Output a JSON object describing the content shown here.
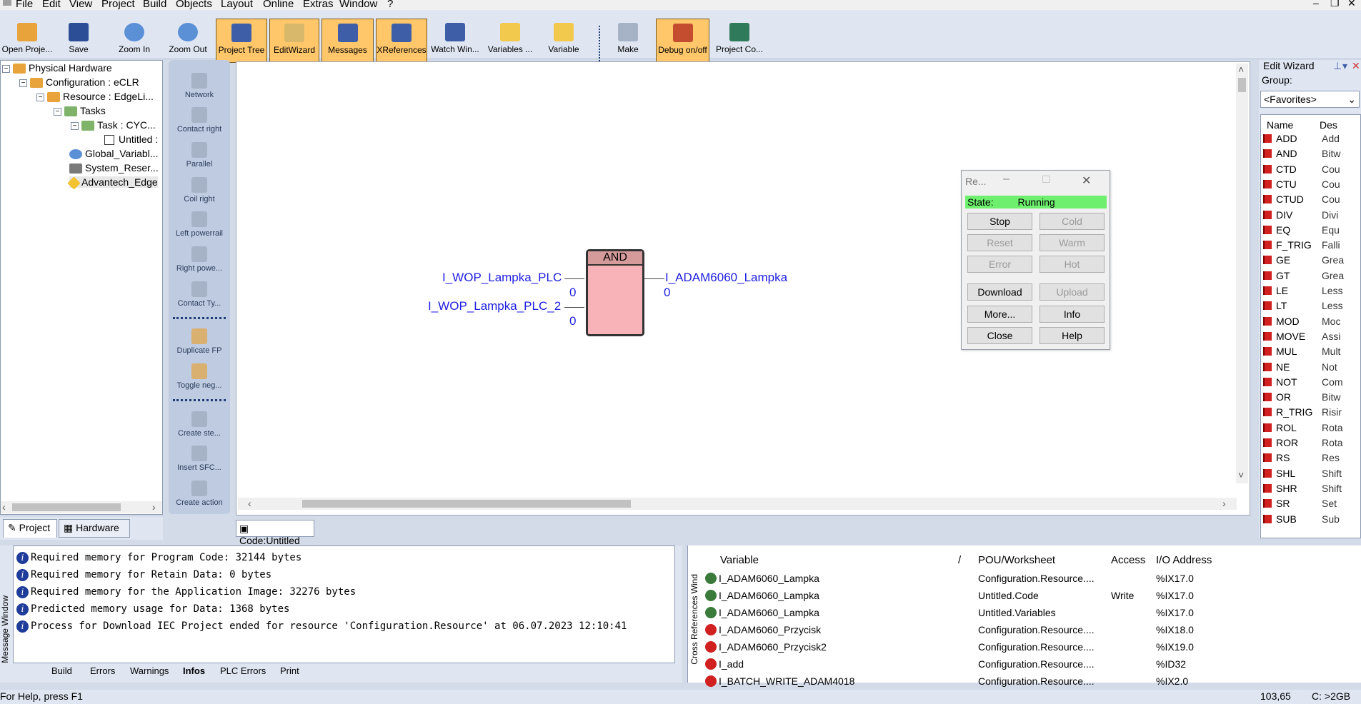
{
  "menu": [
    "File",
    "Edit",
    "View",
    "Project",
    "Build",
    "Objects",
    "Layout",
    "Online",
    "Extras",
    "Window",
    "?"
  ],
  "toolbar": [
    {
      "label": "Open Proje...",
      "icon": "open-project-icon",
      "active": false
    },
    {
      "label": "Save",
      "icon": "save-icon",
      "active": false
    },
    {
      "label": "Zoom In",
      "icon": "zoom-in-icon",
      "active": false
    },
    {
      "label": "Zoom Out",
      "icon": "zoom-out-icon",
      "active": false
    },
    {
      "label": "Project Tree",
      "icon": "project-tree-icon",
      "active": true
    },
    {
      "label": "EditWizard",
      "icon": "edit-wizard-icon",
      "active": true
    },
    {
      "label": "Messages",
      "icon": "messages-icon",
      "active": true
    },
    {
      "label": "XReferences",
      "icon": "xreferences-icon",
      "active": true
    },
    {
      "label": "Watch Win...",
      "icon": "watch-window-icon",
      "active": false
    },
    {
      "label": "Variables ...",
      "icon": "variables-icon",
      "active": false
    },
    {
      "label": "Variable",
      "icon": "variable-icon",
      "active": false
    },
    {
      "label": "Make",
      "icon": "make-icon",
      "active": false
    },
    {
      "label": "Debug on/off",
      "icon": "debug-icon",
      "active": true
    },
    {
      "label": "Project Co...",
      "icon": "project-control-icon",
      "active": false
    }
  ],
  "tree": {
    "items": [
      "Physical Hardware",
      "Configuration : eCLR",
      "Resource : EdgeLi...",
      "Tasks",
      "Task : CYC...",
      "Untitled :",
      "Global_Variabl...",
      "System_Reser...",
      "Advantech_Edge"
    ],
    "tabs": [
      "Project",
      "Hardware"
    ]
  },
  "palette": [
    "Network",
    "Contact right",
    "Parallel",
    "Coil right",
    "Left powerrail",
    "Right powe...",
    "Contact Ty...",
    "Duplicate FP",
    "Toggle neg...",
    "Create ste...",
    "Insert SFC...",
    "Create action"
  ],
  "editor": {
    "block_title": "AND",
    "in1": "I_WOP_Lampka_PLC",
    "in1_val": "0",
    "in2": "I_WOP_Lampka_PLC_2",
    "in2_val": "0",
    "out": "I_ADAM6060_Lampka",
    "out_val": "0",
    "tab": "Code:Untitled"
  },
  "resource_dialog": {
    "title": "Re...",
    "state_label": "State:",
    "state_value": "Running",
    "buttons": [
      {
        "label": "Stop",
        "enabled": true
      },
      {
        "label": "Cold",
        "enabled": false
      },
      {
        "label": "Reset",
        "enabled": false
      },
      {
        "label": "Warm",
        "enabled": false
      },
      {
        "label": "Error",
        "enabled": false
      },
      {
        "label": "Hot",
        "enabled": false
      },
      {
        "label": "Download",
        "enabled": true
      },
      {
        "label": "Upload",
        "enabled": false
      },
      {
        "label": "More...",
        "enabled": true
      },
      {
        "label": "Info",
        "enabled": true
      },
      {
        "label": "Close",
        "enabled": true
      },
      {
        "label": "Help",
        "enabled": true
      }
    ]
  },
  "wizard": {
    "title": "Edit Wizard",
    "group_label": "Group:",
    "group_value": "<Favorites>",
    "col_name": "Name",
    "col_desc": "Des",
    "rows": [
      [
        "ADD",
        "Add"
      ],
      [
        "AND",
        "Bitw"
      ],
      [
        "CTD",
        "Cou"
      ],
      [
        "CTU",
        "Cou"
      ],
      [
        "CTUD",
        "Cou"
      ],
      [
        "DIV",
        "Divi"
      ],
      [
        "EQ",
        "Equ"
      ],
      [
        "F_TRIG",
        "Falli"
      ],
      [
        "GE",
        "Grea"
      ],
      [
        "GT",
        "Grea"
      ],
      [
        "LE",
        "Less"
      ],
      [
        "LT",
        "Less"
      ],
      [
        "MOD",
        "Moc"
      ],
      [
        "MOVE",
        "Assi"
      ],
      [
        "MUL",
        "Mult"
      ],
      [
        "NE",
        "Not"
      ],
      [
        "NOT",
        "Com"
      ],
      [
        "OR",
        "Bitw"
      ],
      [
        "R_TRIG",
        "Risir"
      ],
      [
        "ROL",
        "Rota"
      ],
      [
        "ROR",
        "Rota"
      ],
      [
        "RS",
        "Res"
      ],
      [
        "SHL",
        "Shift"
      ],
      [
        "SHR",
        "Shift"
      ],
      [
        "SR",
        "Set"
      ],
      [
        "SUB",
        "Sub"
      ]
    ]
  },
  "messages": {
    "side_label": "Message Window",
    "lines": [
      "Required memory for Program Code: 32144 bytes",
      "Required memory for Retain Data: 0 bytes",
      "Required memory for the Application Image: 32276 bytes",
      "Predicted memory usage for Data: 1368 bytes",
      "Process for Download IEC Project ended for resource 'Configuration.Resource' at 06.07.2023 12:10:41"
    ],
    "tabs": [
      "Build",
      "Errors",
      "Warnings",
      "Infos",
      "PLC Errors",
      "Print"
    ],
    "active_tab": "Infos"
  },
  "xref": {
    "side_label": "Cross References Wind",
    "headers": [
      "Variable",
      "/",
      "POU/Worksheet",
      "Access",
      "I/O Address"
    ],
    "rows": [
      [
        "I_ADAM6060_Lampka",
        "Configuration.Resource....",
        "",
        "%IX17.0"
      ],
      [
        "I_ADAM6060_Lampka",
        "Untitled.Code",
        "Write",
        "%IX17.0"
      ],
      [
        "I_ADAM6060_Lampka",
        "Untitled.Variables",
        "",
        "%IX17.0"
      ],
      [
        "I_ADAM6060_Przycisk",
        "Configuration.Resource....",
        "",
        "%IX18.0"
      ],
      [
        "I_ADAM6060_Przycisk2",
        "Configuration.Resource....",
        "",
        "%IX19.0"
      ],
      [
        "I_add",
        "Configuration.Resource....",
        "",
        "%ID32"
      ],
      [
        "I_BATCH_WRITE_ADAM4018",
        "Configuration.Resource....",
        "",
        "%IX2.0"
      ]
    ]
  },
  "status": {
    "help": "For Help, press F1",
    "pos": "103,65",
    "drive": "C: >2GB"
  },
  "colors": {
    "accent": "#ffc76a",
    "fb_fill": "#f7b3b7",
    "running": "#6ef06e",
    "var_blue": "#1d1de0"
  }
}
